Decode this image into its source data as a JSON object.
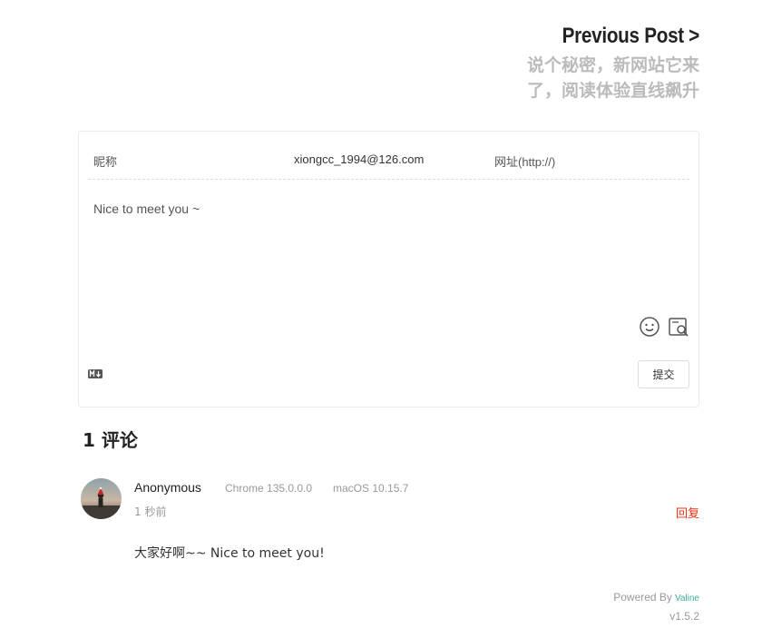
{
  "prev": {
    "label": "Previous Post",
    "arrow": ">",
    "title": "说个秘密，新网站它来了，阅读体验直线飙升"
  },
  "comment_form": {
    "nick_placeholder": "昵称",
    "mail_value": "xiongcc_1994@126.com",
    "link_placeholder": "网址(http://)",
    "editor_placeholder": "Nice to meet you ~",
    "submit_label": "提交",
    "icons": [
      "emoji-icon",
      "preview-icon",
      "markdown-icon"
    ]
  },
  "comments": {
    "count_label": "1 评论",
    "items": [
      {
        "nick": "Anonymous",
        "browser": "Chrome 135.0.0.0",
        "os": "macOS 10.15.7",
        "time": "1 秒前",
        "reply_label": "回复",
        "content": "大家好啊~~ Nice to meet you!"
      }
    ]
  },
  "footer": {
    "powered_prefix": "Powered By",
    "powered_brand": "Valine",
    "version": "v1.5.2"
  },
  "colors": {
    "reply": "#ef2f11",
    "brand": "#3eaf9f",
    "muted": "#999999"
  }
}
